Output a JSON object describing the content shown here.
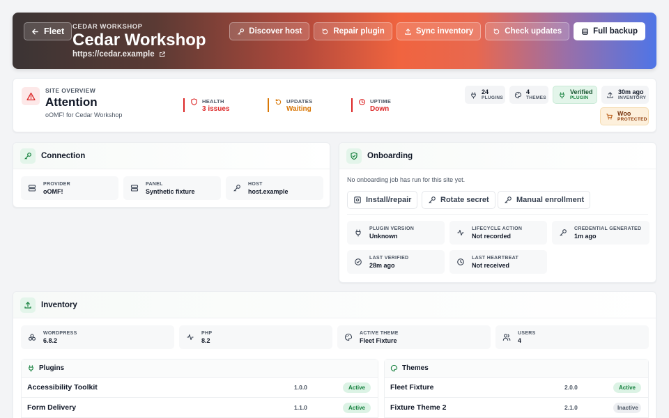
{
  "header": {
    "back_label": "Fleet",
    "eyebrow": "CEDAR WORKSHOP",
    "title": "Cedar Workshop",
    "url": "https://cedar.example",
    "actions": [
      {
        "label": "Discover host",
        "icon": "key-icon"
      },
      {
        "label": "Repair plugin",
        "icon": "refresh-icon"
      },
      {
        "label": "Sync inventory",
        "icon": "upload-icon"
      },
      {
        "label": "Check updates",
        "icon": "refresh-icon"
      },
      {
        "label": "Full backup",
        "icon": "database-icon"
      }
    ]
  },
  "overview": {
    "eyebrow": "SITE OVERVIEW",
    "title": "Attention",
    "subtitle": "oOMF! for Cedar Workshop",
    "stats": [
      {
        "label": "HEALTH",
        "value": "3 issues",
        "color": "#dc2626"
      },
      {
        "label": "UPDATES",
        "value": "Waiting",
        "color": "#d97706"
      },
      {
        "label": "UPTIME",
        "value": "Down",
        "color": "#dc2626"
      }
    ],
    "pills": [
      {
        "value": "24",
        "label": "PLUGINS"
      },
      {
        "value": "4",
        "label": "THEMES"
      },
      {
        "value": "Verified",
        "label": "PLUGIN"
      },
      {
        "value": "30m ago",
        "label": "INVENTORY"
      },
      {
        "value": "Woo",
        "label": "PROTECTED"
      }
    ]
  },
  "connection": {
    "title": "Connection",
    "tiles": [
      {
        "label": "PROVIDER",
        "value": "oOMF!"
      },
      {
        "label": "PANEL",
        "value": "Synthetic fixture"
      },
      {
        "label": "HOST",
        "value": "host.example"
      }
    ]
  },
  "onboarding": {
    "title": "Onboarding",
    "message": "No onboarding job has run for this site yet.",
    "buttons": [
      "Install/repair",
      "Rotate secret",
      "Manual enrollment"
    ],
    "tiles": [
      {
        "label": "PLUGIN VERSION",
        "value": "Unknown"
      },
      {
        "label": "LIFECYCLE ACTION",
        "value": "Not recorded"
      },
      {
        "label": "CREDENTIAL GENERATED",
        "value": "1m ago"
      },
      {
        "label": "LAST VERIFIED",
        "value": "28m ago"
      },
      {
        "label": "LAST HEARTBEAT",
        "value": "Not received"
      }
    ]
  },
  "inventory": {
    "title": "Inventory",
    "tiles": [
      {
        "label": "WORDPRESS",
        "value": "6.8.2"
      },
      {
        "label": "PHP",
        "value": "8.2"
      },
      {
        "label": "ACTIVE THEME",
        "value": "Fleet Fixture"
      },
      {
        "label": "USERS",
        "value": "4"
      }
    ],
    "plugins": {
      "title": "Plugins",
      "rows": [
        {
          "name": "Accessibility Toolkit",
          "version": "1.0.0",
          "status": "Active"
        },
        {
          "name": "Form Delivery",
          "version": "1.1.0",
          "status": "Active"
        }
      ]
    },
    "themes": {
      "title": "Themes",
      "rows": [
        {
          "name": "Fleet Fixture",
          "version": "2.0.0",
          "status": "Active"
        },
        {
          "name": "Fixture Theme 2",
          "version": "2.1.0",
          "status": "Inactive"
        }
      ]
    }
  }
}
